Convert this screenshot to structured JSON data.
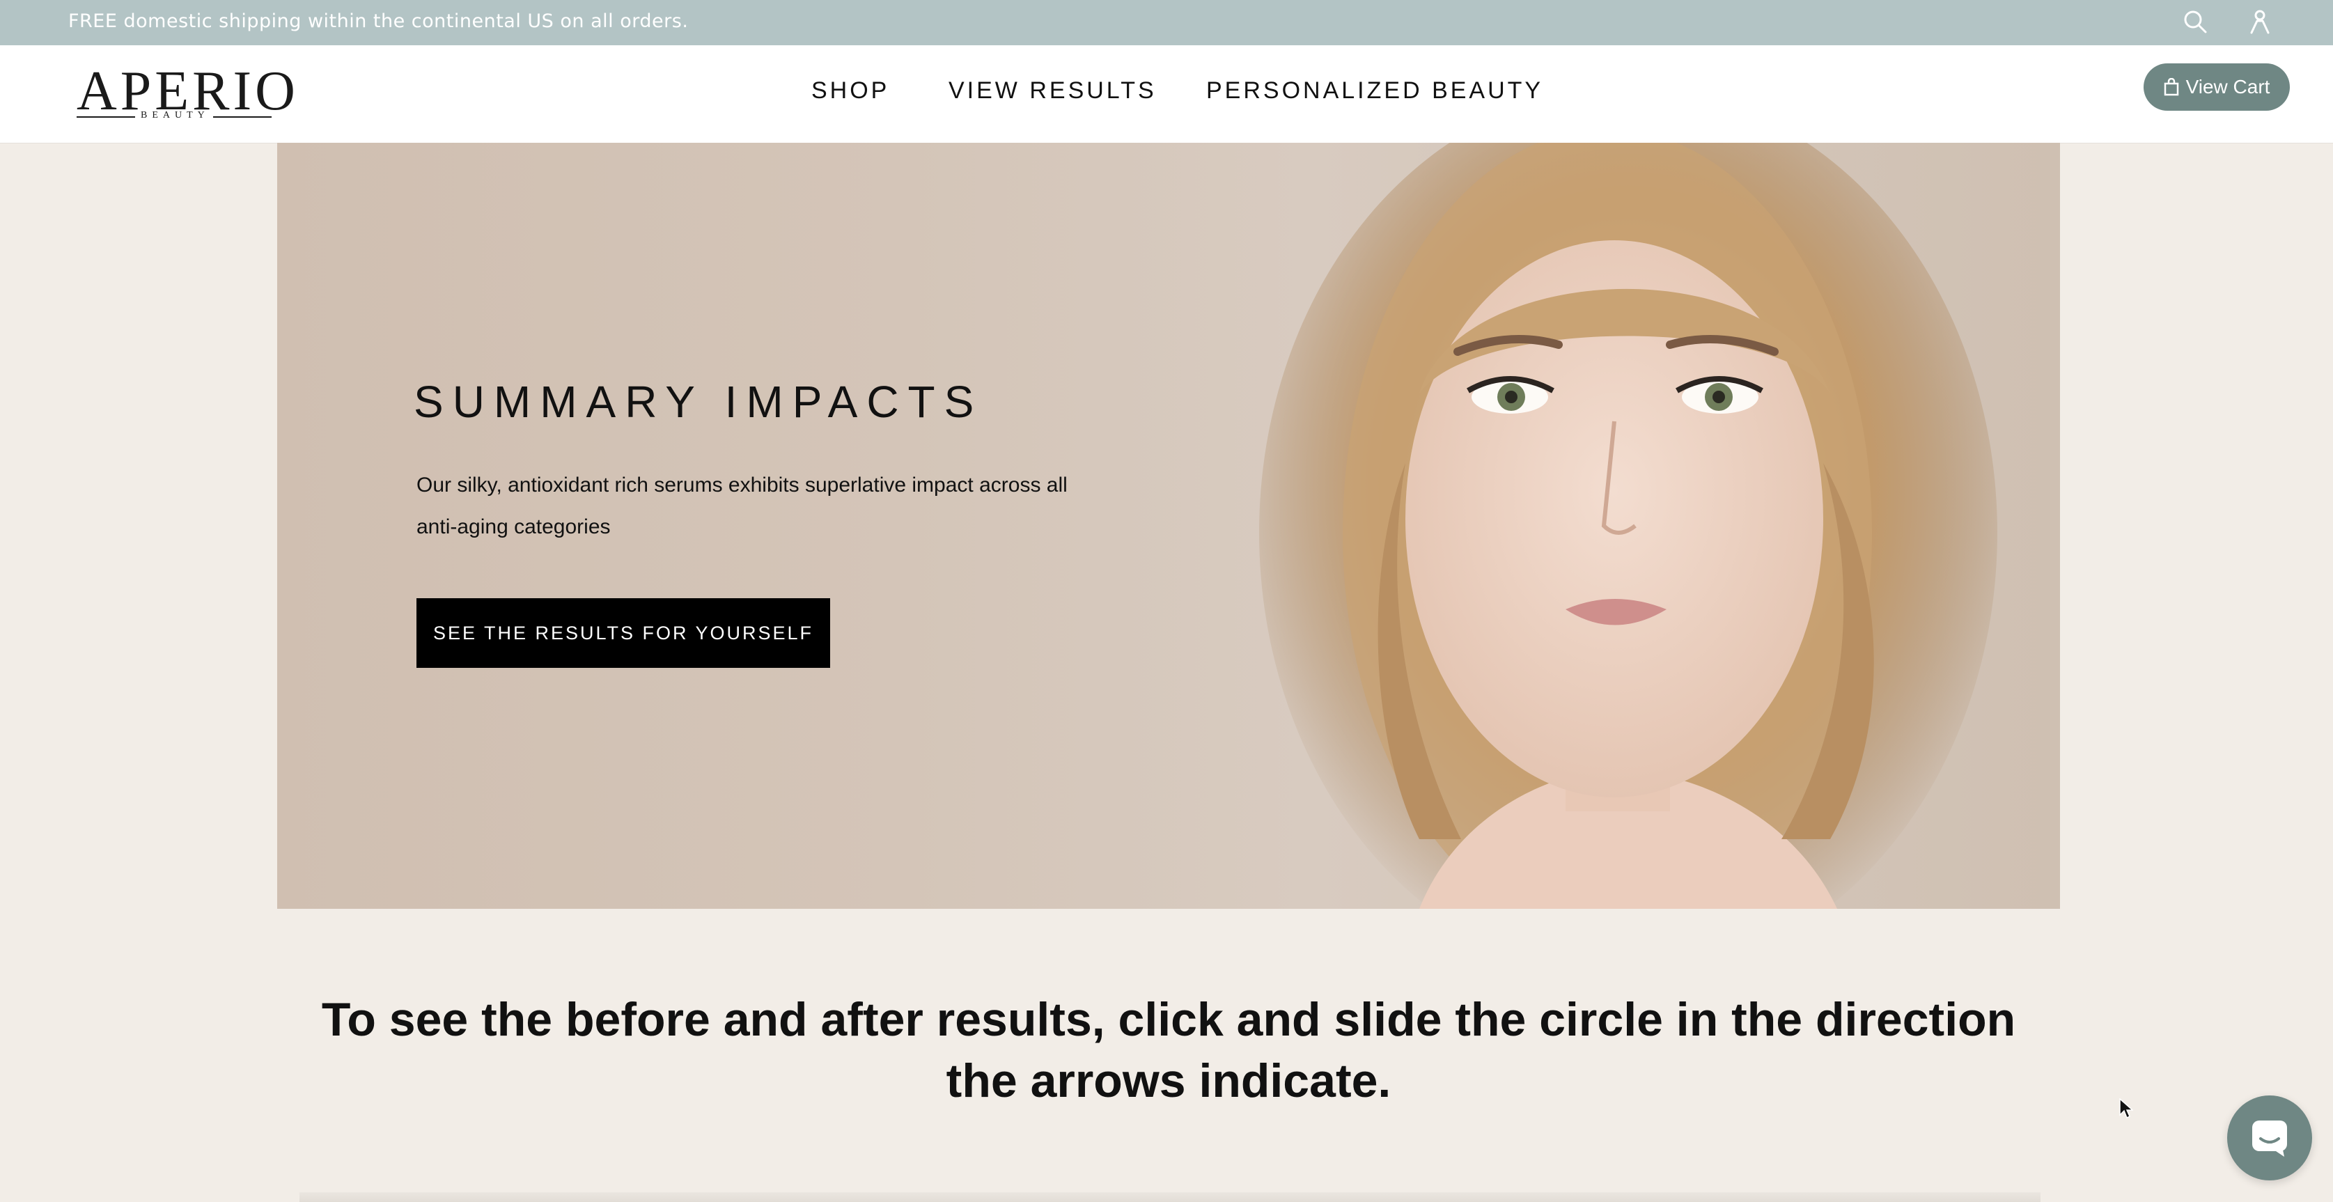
{
  "announcement": {
    "text": "FREE domestic shipping within the continental US on all orders."
  },
  "header": {
    "logo": {
      "main": "APERIO",
      "sub": "BEAUTY"
    },
    "nav": [
      {
        "label": "SHOP"
      },
      {
        "label": "VIEW RESULTS"
      },
      {
        "label": "PERSONALIZED BEAUTY"
      }
    ],
    "cart": {
      "label": "View Cart",
      "icon": "shopping-bag-icon"
    },
    "icons": {
      "search": "search-icon",
      "account": "account-icon"
    }
  },
  "hero": {
    "title": "SUMMARY IMPACTS",
    "body": "Our silky, antioxidant rich serums exhibits superlative impact across all anti-aging categories",
    "cta_label": "SEE THE RESULTS FOR YOURSELF"
  },
  "instructions": {
    "text": "To see the before and after results, click and slide the circle in the direction the arrows indicate."
  },
  "chat": {
    "icon": "chat-icon"
  },
  "colors": {
    "announcement_bar": "#b3c4c5",
    "page_background": "#f2ede7",
    "accent": "#6f8784",
    "cta_background": "#000000"
  }
}
